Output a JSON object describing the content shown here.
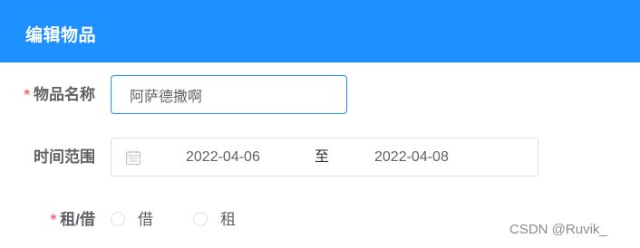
{
  "dialog": {
    "title": "编辑物品"
  },
  "form": {
    "name": {
      "required_mark": "*",
      "label": "物品名称",
      "value": "阿萨德撒啊"
    },
    "time_range": {
      "label": "时间范围",
      "start": "2022-04-06",
      "separator": "至",
      "end": "2022-04-08",
      "icon": "calendar-icon"
    },
    "mode": {
      "required_mark": "*",
      "label": "租/借",
      "options": [
        {
          "label": "借",
          "checked": false
        },
        {
          "label": "租",
          "checked": false
        }
      ]
    }
  },
  "watermark": "CSDN @Ruvik_",
  "colors": {
    "header": "#1e90ff",
    "required": "#f56c6c",
    "focus_border": "#1e90ff",
    "label": "#606266"
  }
}
